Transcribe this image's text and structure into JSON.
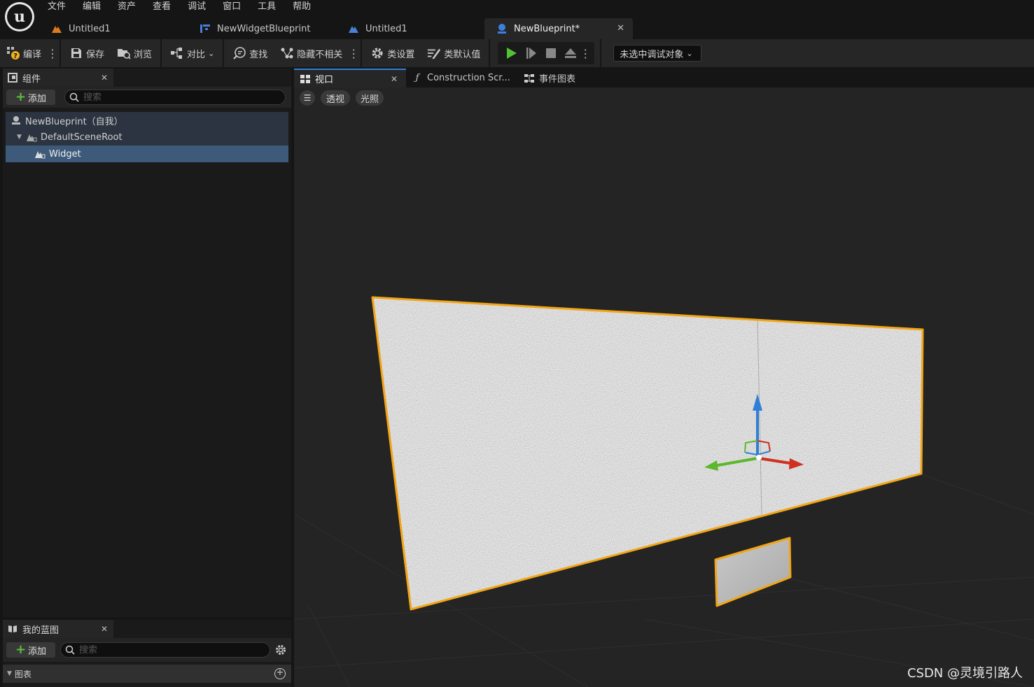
{
  "menu": [
    "文件",
    "编辑",
    "资产",
    "查看",
    "调试",
    "窗口",
    "工具",
    "帮助"
  ],
  "document_tabs": [
    {
      "label": "Untitled1",
      "icon": "level-icon"
    },
    {
      "label": "NewWidgetBlueprint",
      "icon": "widget-blueprint-icon"
    },
    {
      "label": "Untitled1",
      "icon": "level-icon"
    },
    {
      "label": "NewBlueprint*",
      "icon": "blueprint-icon",
      "active": true
    }
  ],
  "toolbar": {
    "compile": "编译",
    "save": "保存",
    "browse": "浏览",
    "diff": "对比",
    "find": "查找",
    "hide_unrelated": "隐藏不相关",
    "class_settings": "类设置",
    "class_defaults": "类默认值",
    "debug_target": "未选中调试对象"
  },
  "components_panel": {
    "tab_label": "组件",
    "add_label": "添加",
    "search_placeholder": "搜索",
    "tree": [
      {
        "label": "NewBlueprint（自我）",
        "depth": 0
      },
      {
        "label": "DefaultSceneRoot",
        "depth": 1
      },
      {
        "label": "Widget",
        "depth": 2,
        "selected": true
      }
    ]
  },
  "my_blueprint": {
    "tab_label": "我的蓝图",
    "add_label": "添加",
    "search_placeholder": "搜索",
    "category": "图表"
  },
  "viewport_tabs": [
    {
      "label": "视口",
      "active": true
    },
    {
      "label": "Construction Scr...",
      "active": false
    },
    {
      "label": "事件图表",
      "active": false
    }
  ],
  "viewport": {
    "perspective": "透视",
    "lighting": "光照"
  },
  "watermark": "CSDN @灵境引路人",
  "colors": {
    "accent_blue": "#2f7fd6",
    "selection_outline": "#f2a516",
    "play_green": "#52c234",
    "add_green": "#5cc03c"
  }
}
